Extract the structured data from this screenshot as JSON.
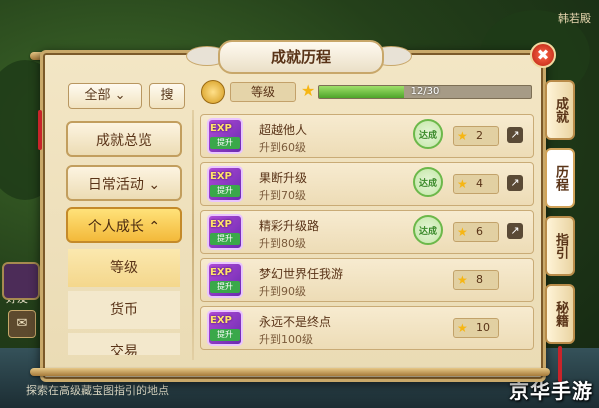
{
  "background": {
    "top_right_label": "韩若殿",
    "left_label": "好友",
    "bottom_text": "探索在高级藏宝图指引的地点",
    "watermark": "京华手游"
  },
  "panel": {
    "title": "成就历程",
    "close_label": "✖"
  },
  "filter": {
    "select_label": "全部",
    "search_label": "搜"
  },
  "nav": {
    "overview": "成就总览",
    "daily": "日常活动",
    "growth": "个人成长",
    "sub_items": [
      {
        "label": "等级"
      },
      {
        "label": "货币"
      },
      {
        "label": "交易"
      }
    ]
  },
  "level_bar": {
    "label": "等级",
    "progress_text": "12/30",
    "progress": 0.4
  },
  "achievements": [
    {
      "name": "超越他人",
      "desc": "升到60级",
      "points": "2",
      "completed": true,
      "stamp": "达成"
    },
    {
      "name": "果断升级",
      "desc": "升到70级",
      "points": "4",
      "completed": true,
      "stamp": "达成"
    },
    {
      "name": "精彩升级路",
      "desc": "升到80级",
      "points": "6",
      "completed": true,
      "stamp": "达成"
    },
    {
      "name": "梦幻世界任我游",
      "desc": "升到90级",
      "points": "8",
      "completed": false,
      "stamp": ""
    },
    {
      "name": "永远不是终点",
      "desc": "升到100级",
      "points": "10",
      "completed": false,
      "stamp": ""
    }
  ],
  "icon_text": {
    "exp": "EXP",
    "up": "提升"
  },
  "side_tabs": [
    {
      "label": "成就",
      "active": false
    },
    {
      "label": "历程",
      "active": true
    },
    {
      "label": "指引",
      "active": false
    },
    {
      "label": "秘籍",
      "active": false
    }
  ],
  "colors": {
    "accent_gold": "#f3b93a",
    "progress_green": "#4ea52a",
    "close_red": "#b81f10"
  }
}
